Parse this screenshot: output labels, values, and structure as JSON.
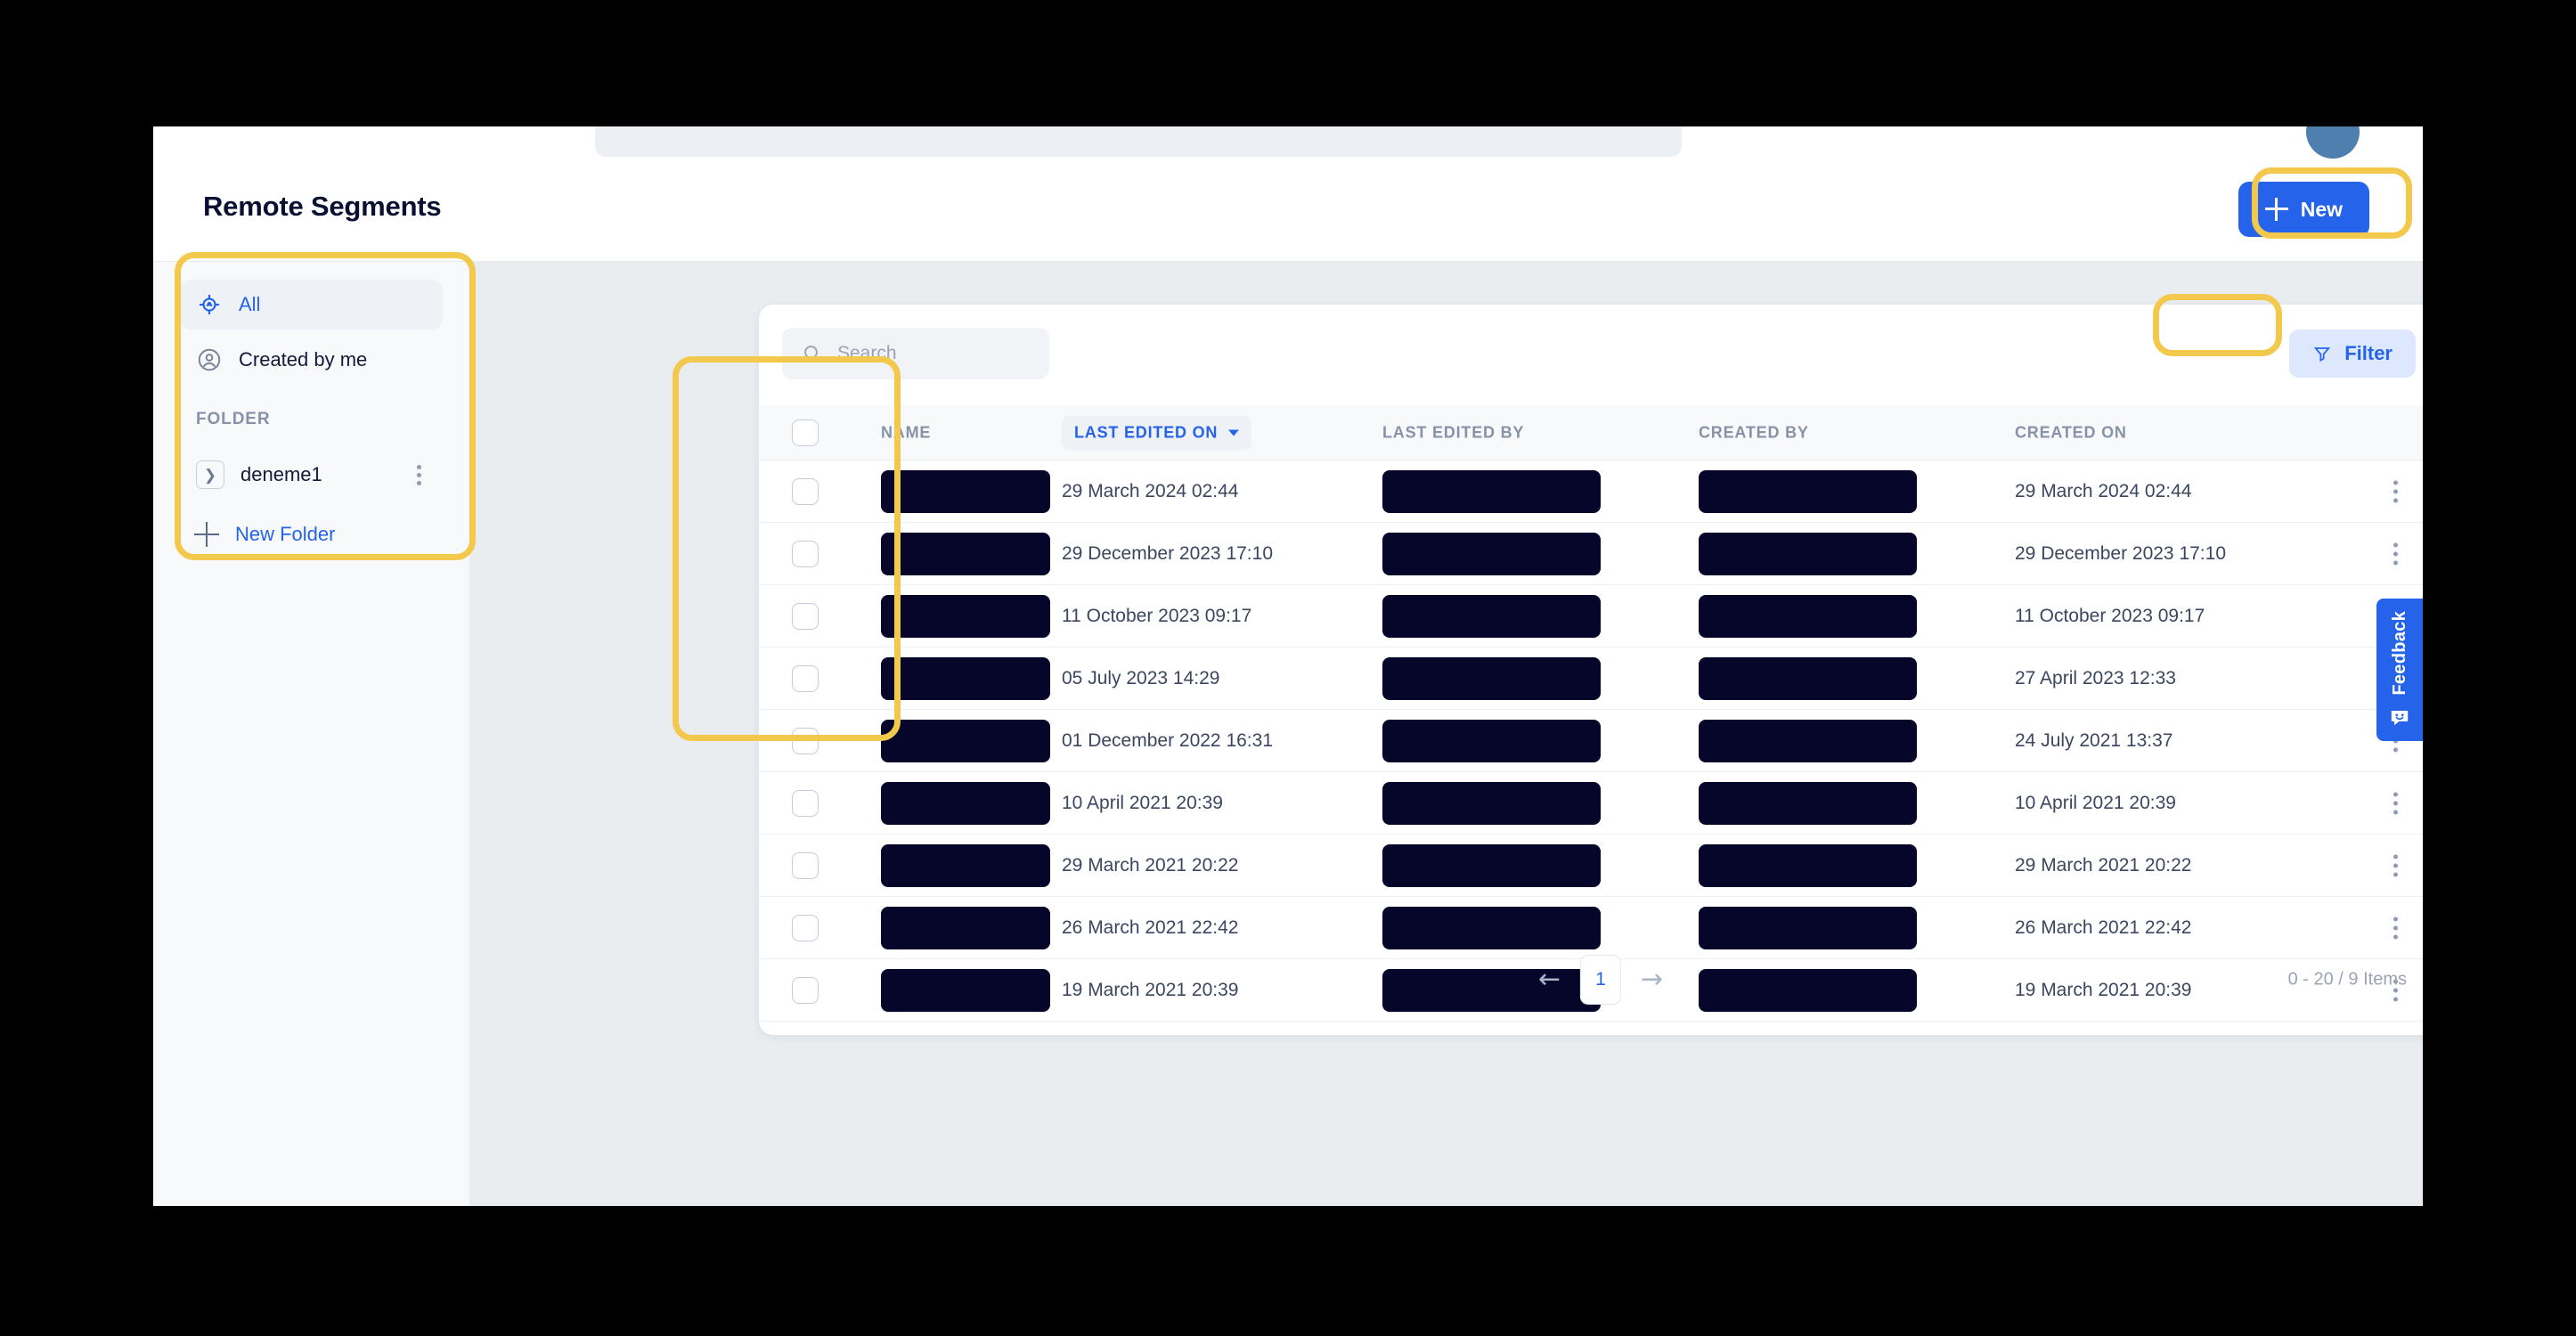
{
  "header": {
    "title": "Remote Segments",
    "new_button_label": "New",
    "new_button_icon": "plus-icon"
  },
  "sidebar": {
    "items": [
      {
        "label": "All",
        "icon": "target-crosshair-icon",
        "active": true
      },
      {
        "label": "Created by me",
        "icon": "user-circle-icon",
        "active": false
      }
    ],
    "folder_section_label": "FOLDER",
    "folders": [
      {
        "label": "deneme1",
        "expander_icon": "chevron-right-icon",
        "menu_icon": "kebab-menu-icon"
      }
    ],
    "new_folder_label": "New Folder",
    "new_folder_icon": "plus-icon"
  },
  "toolbar": {
    "search_placeholder": "Search",
    "search_value": "",
    "search_icon": "search-icon",
    "filter_label": "Filter",
    "filter_icon": "funnel-icon"
  },
  "table": {
    "columns": [
      {
        "key": "checkbox",
        "label": "",
        "sorted": false
      },
      {
        "key": "name",
        "label": "NAME",
        "sorted": false
      },
      {
        "key": "last_edited_on",
        "label": "LAST EDITED ON",
        "sorted": true,
        "sort_icon": "caret-down-icon"
      },
      {
        "key": "last_edited_by",
        "label": "LAST EDITED BY",
        "sorted": false
      },
      {
        "key": "created_by",
        "label": "CREATED BY",
        "sorted": false
      },
      {
        "key": "created_on",
        "label": "CREATED ON",
        "sorted": false
      }
    ],
    "rows": [
      {
        "name": "",
        "last_edited_on": "29 March 2024 02:44",
        "last_edited_by": "",
        "created_by": "",
        "created_on": "29 March 2024 02:44"
      },
      {
        "name": "",
        "last_edited_on": "29 December 2023 17:10",
        "last_edited_by": "",
        "created_by": "",
        "created_on": "29 December 2023 17:10"
      },
      {
        "name": "",
        "last_edited_on": "11 October 2023 09:17",
        "last_edited_by": "",
        "created_by": "",
        "created_on": "11 October 2023 09:17"
      },
      {
        "name": "",
        "last_edited_on": "05 July 2023 14:29",
        "last_edited_by": "",
        "created_by": "",
        "created_on": "27 April 2023 12:33"
      },
      {
        "name": "",
        "last_edited_on": "01 December 2022 16:31",
        "last_edited_by": "",
        "created_by": "",
        "created_on": "24 July 2021 13:37"
      },
      {
        "name": "",
        "last_edited_on": "10 April 2021 20:39",
        "last_edited_by": "",
        "created_by": "",
        "created_on": "10 April 2021 20:39"
      },
      {
        "name": "",
        "last_edited_on": "29 March 2021 20:22",
        "last_edited_by": "",
        "created_by": "",
        "created_on": "29 March 2021 20:22"
      },
      {
        "name": "",
        "last_edited_on": "26 March 2021 22:42",
        "last_edited_by": "",
        "created_by": "",
        "created_on": "26 March 2021 22:42"
      },
      {
        "name": "",
        "last_edited_on": "19 March 2021 20:39",
        "last_edited_by": "",
        "created_by": "",
        "created_on": "19 March 2021 20:39"
      }
    ],
    "row_menu_icon": "kebab-menu-icon"
  },
  "pagination": {
    "prev_icon": "arrow-left-icon",
    "next_icon": "arrow-right-icon",
    "current_page": "1",
    "item_count": "0 - 20 / 9 Items"
  },
  "feedback": {
    "label": "Feedback",
    "icon": "smiley-chat-icon"
  },
  "colors": {
    "accent_blue": "#2563eb",
    "annotation_yellow": "#f2c94c",
    "redaction": "#05062a",
    "content_bg": "#e9edf0",
    "sidebar_bg": "#f8f9fb"
  }
}
